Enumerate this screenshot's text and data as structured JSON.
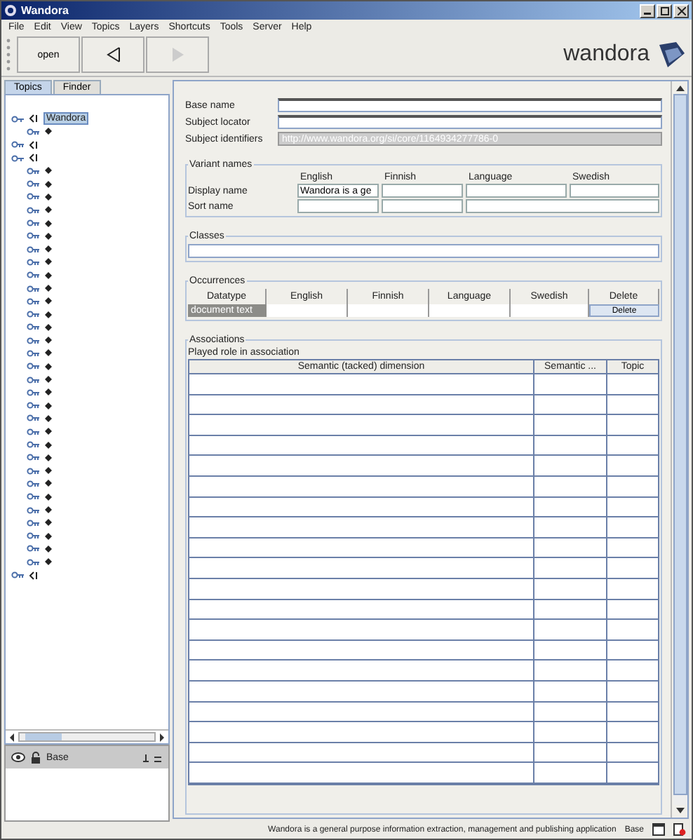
{
  "window": {
    "title": "Wandora"
  },
  "menu": [
    "File",
    "Edit",
    "View",
    "Topics",
    "Layers",
    "Shortcuts",
    "Tools",
    "Server",
    "Help"
  ],
  "toolbar": [
    {
      "kind": "text",
      "label": "open",
      "disabled": false
    },
    {
      "kind": "back",
      "disabled": false
    },
    {
      "kind": "forward",
      "disabled": true
    }
  ],
  "logo": {
    "text": "wandora"
  },
  "left_tabs": [
    {
      "label": "Topics",
      "selected": true
    },
    {
      "label": "Finder",
      "selected": false
    }
  ],
  "tree": [
    {
      "kind": "class",
      "label": "Wandora",
      "selected": true,
      "expanded": true,
      "children": [
        {
          "kind": "topic"
        }
      ]
    },
    {
      "kind": "class",
      "expanded": false
    },
    {
      "kind": "class",
      "expanded": true,
      "children": [
        {
          "kind": "topic"
        },
        {
          "kind": "topic"
        },
        {
          "kind": "topic"
        },
        {
          "kind": "topic"
        },
        {
          "kind": "topic"
        },
        {
          "kind": "topic"
        },
        {
          "kind": "topic"
        },
        {
          "kind": "topic"
        },
        {
          "kind": "topic"
        },
        {
          "kind": "topic"
        },
        {
          "kind": "topic"
        },
        {
          "kind": "topic"
        },
        {
          "kind": "topic"
        },
        {
          "kind": "topic"
        },
        {
          "kind": "topic"
        },
        {
          "kind": "topic"
        },
        {
          "kind": "topic"
        },
        {
          "kind": "topic"
        },
        {
          "kind": "topic"
        },
        {
          "kind": "topic"
        },
        {
          "kind": "topic"
        },
        {
          "kind": "topic"
        },
        {
          "kind": "topic"
        },
        {
          "kind": "topic"
        },
        {
          "kind": "topic"
        },
        {
          "kind": "topic"
        },
        {
          "kind": "topic"
        },
        {
          "kind": "topic"
        },
        {
          "kind": "topic"
        },
        {
          "kind": "topic"
        },
        {
          "kind": "topic"
        }
      ]
    },
    {
      "kind": "class",
      "expanded": false
    }
  ],
  "layers": [
    {
      "label": "Base",
      "visible": true,
      "locked": false
    }
  ],
  "fields": [
    {
      "label": "Base name",
      "disabled": false
    },
    {
      "label": "Subject locator",
      "disabled": false
    },
    {
      "label": "Subject identifiers",
      "value": "http://www.wandora.org/si/core/1164934277786-0",
      "disabled": true
    }
  ],
  "variant_names": {
    "title": "Variant names",
    "columns": [
      "English",
      "Finnish",
      "Language",
      "Swedish"
    ],
    "rows": [
      {
        "label": "Display name",
        "cells": [
          {
            "value": "Wandora is a ge"
          },
          {},
          {},
          {}
        ]
      },
      {
        "label": "Sort name",
        "cells": [
          {},
          {},
          {
            "wide": true
          }
        ]
      }
    ]
  },
  "classes": {
    "title": "Classes"
  },
  "occurrences": {
    "title": "Occurrences",
    "columns": [
      "Datatype",
      "English",
      "Finnish",
      "Language",
      "Swedish",
      "Delete"
    ],
    "rows": [
      {
        "type": "document text",
        "action": "Delete"
      }
    ]
  },
  "associations": {
    "title": "Associations",
    "caption": "Played role in association",
    "columns": [
      "Semantic (tacked) dimension",
      "Semantic ...",
      "Topic"
    ]
  },
  "status_bar": {
    "text": "Wandora is a general purpose information extraction, management and publishing application",
    "layer": "Base"
  }
}
